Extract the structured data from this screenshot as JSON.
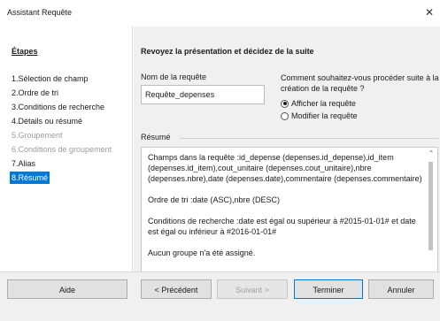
{
  "window": {
    "title": "Assistant Requête"
  },
  "sidebar": {
    "title": "Étapes",
    "steps": [
      {
        "label": "1.Sélection de champ",
        "state": "normal"
      },
      {
        "label": "2.Ordre de tri",
        "state": "normal"
      },
      {
        "label": "3.Conditions de recherche",
        "state": "normal"
      },
      {
        "label": "4.Détails ou résumé",
        "state": "normal"
      },
      {
        "label": "5.Groupement",
        "state": "disabled"
      },
      {
        "label": "6.Conditions de groupement",
        "state": "disabled"
      },
      {
        "label": "7.Alias",
        "state": "normal"
      },
      {
        "label": "8.Résumé",
        "state": "active"
      }
    ]
  },
  "main": {
    "heading": "Revoyez la présentation et décidez de la suite",
    "query_name_label": "Nom de la requête",
    "query_name_value": "Requête_depenses",
    "question": "Comment souhaitez-vous procéder suite à la création de la requête ?",
    "options": [
      {
        "label": "Afficher la requête",
        "selected": true
      },
      {
        "label": "Modifier la requête",
        "selected": false
      }
    ],
    "summary_label": "Résumé",
    "summary_paragraphs": [
      "Champs dans la requête :id_depense (depenses.id_depense),id_item (depenses.id_item),cout_unitaire (depenses.cout_unitaire),nbre (depenses.nbre),date (depenses.date),commentaire (depenses.commentaire)",
      "Ordre de tri :date (ASC),nbre (DESC)",
      "Conditions de recherche :date est égal ou supérieur à #2015-01-01# et date est égal ou inférieur à #2016-01-01#",
      "Aucun groupe n'a été assigné."
    ]
  },
  "footer": {
    "help_label": "Aide",
    "prev_label": "< Précédent",
    "next_label": "Suivant >",
    "finish_label": "Terminer",
    "cancel_label": "Annuler"
  },
  "colors": {
    "active_step": "#0078d7",
    "disabled_text": "#9c9c9c",
    "panel_bg": "#f0f0f0"
  }
}
